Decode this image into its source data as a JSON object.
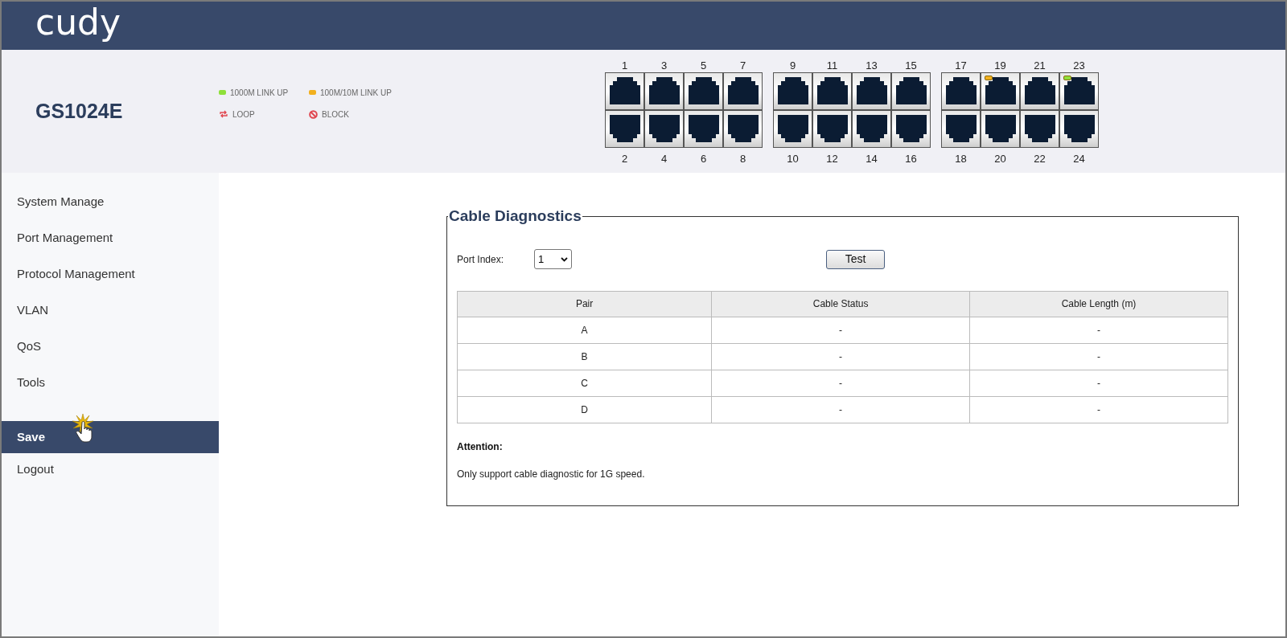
{
  "header": {
    "logo": "cudy"
  },
  "banner": {
    "model": "GS1024E",
    "legend": [
      {
        "kind": "led",
        "label": "1000M LINK UP",
        "color": "#8fe03a"
      },
      {
        "kind": "led",
        "label": "100M/10M LINK UP",
        "color": "#f2b01e"
      },
      {
        "kind": "loop",
        "label": "LOOP",
        "color": "#e0454f"
      },
      {
        "kind": "block",
        "label": "BLOCK",
        "color": "#e0454f"
      }
    ],
    "port_groups": [
      {
        "ports": [
          {
            "top": {
              "label": "1"
            },
            "bottom": {
              "label": "2"
            }
          },
          {
            "top": {
              "label": "3"
            },
            "bottom": {
              "label": "4"
            }
          },
          {
            "top": {
              "label": "5"
            },
            "bottom": {
              "label": "6"
            }
          },
          {
            "top": {
              "label": "7"
            },
            "bottom": {
              "label": "8"
            }
          }
        ]
      },
      {
        "ports": [
          {
            "top": {
              "label": "9"
            },
            "bottom": {
              "label": "10"
            }
          },
          {
            "top": {
              "label": "11"
            },
            "bottom": {
              "label": "12"
            }
          },
          {
            "top": {
              "label": "13"
            },
            "bottom": {
              "label": "14"
            }
          },
          {
            "top": {
              "label": "15"
            },
            "bottom": {
              "label": "16"
            }
          }
        ]
      },
      {
        "ports": [
          {
            "top": {
              "label": "17"
            },
            "bottom": {
              "label": "18"
            }
          },
          {
            "top": {
              "label": "19",
              "color": "#f2b01e"
            },
            "bottom": {
              "label": "20"
            }
          },
          {
            "top": {
              "label": "21"
            },
            "bottom": {
              "label": "22"
            }
          },
          {
            "top": {
              "label": "23",
              "color": "#8fe03a"
            },
            "bottom": {
              "label": "24"
            }
          }
        ]
      }
    ]
  },
  "sidebar": {
    "items": [
      {
        "label": "System Manage",
        "selected": false
      },
      {
        "label": "Port Management",
        "selected": false
      },
      {
        "label": "Protocol Management",
        "selected": false
      },
      {
        "label": "VLAN",
        "selected": false
      },
      {
        "label": "QoS",
        "selected": false
      },
      {
        "label": "Tools",
        "selected": false
      }
    ],
    "bottom_items": [
      {
        "label": "Save",
        "selected": true
      },
      {
        "label": "Logout",
        "selected": false
      }
    ]
  },
  "panel": {
    "title": "Cable Diagnostics",
    "port_index_label": "Port Index:",
    "port_index_value": "1",
    "test_button": "Test",
    "table": {
      "columns": [
        "Pair",
        "Cable Status",
        "Cable Length (m)"
      ],
      "rows": [
        [
          "A",
          "-",
          "-"
        ],
        [
          "B",
          "-",
          "-"
        ],
        [
          "C",
          "-",
          "-"
        ],
        [
          "D",
          "-",
          "-"
        ]
      ]
    },
    "attention_title": "Attention:",
    "attention_text": "Only support cable diagnostic for 1G speed."
  }
}
